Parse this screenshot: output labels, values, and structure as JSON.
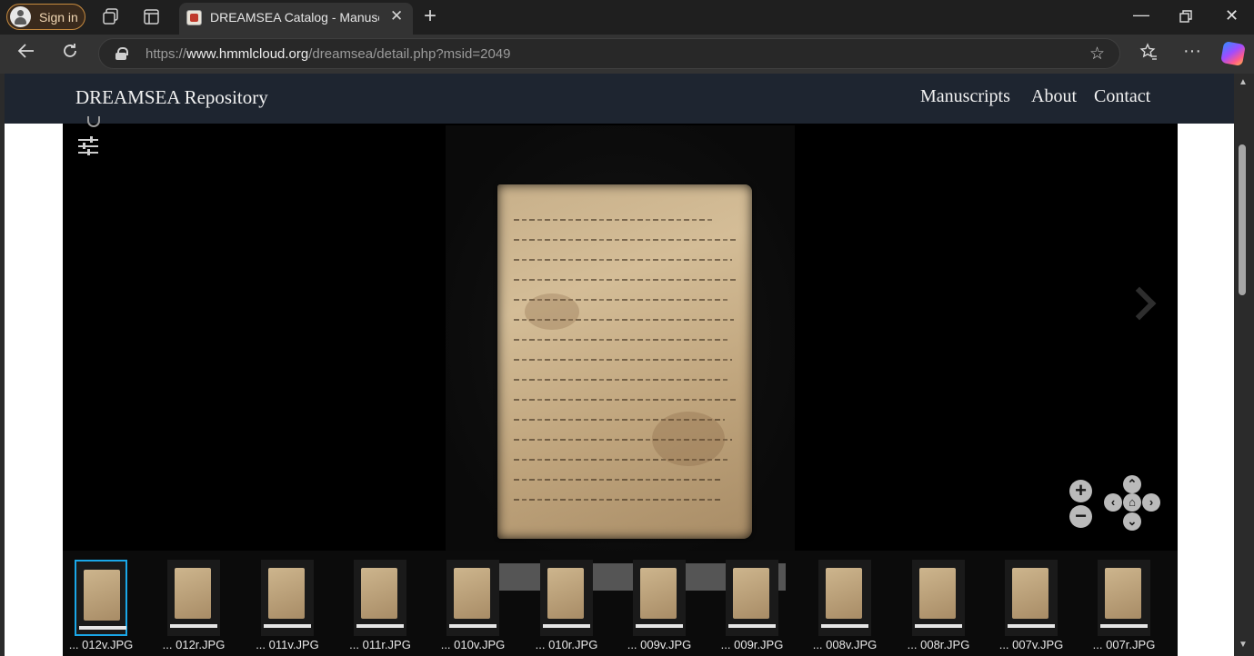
{
  "browser": {
    "signin_label": "Sign in",
    "tab_title": "DREAMSEA Catalog - Manuscript",
    "url_prefix": "https://",
    "url_host": "www.hmmlcloud.org",
    "url_path": "/dreamsea/detail.php?msid=2049"
  },
  "site": {
    "brand": "DREAMSEA Repository",
    "menu": [
      "Manuscripts",
      "About",
      "Contact"
    ]
  },
  "viewer": {
    "thumbnails": [
      {
        "label": "...  012v.JPG",
        "selected": true
      },
      {
        "label": "...  012r.JPG",
        "selected": false
      },
      {
        "label": "...  011v.JPG",
        "selected": false
      },
      {
        "label": "...  011r.JPG",
        "selected": false
      },
      {
        "label": "...  010v.JPG",
        "selected": false
      },
      {
        "label": "...  010r.JPG",
        "selected": false
      },
      {
        "label": "...  009v.JPG",
        "selected": false
      },
      {
        "label": "...  009r.JPG",
        "selected": false
      },
      {
        "label": "...  008v.JPG",
        "selected": false
      },
      {
        "label": "...  008r.JPG",
        "selected": false
      },
      {
        "label": "...  007v.JPG",
        "selected": false
      },
      {
        "label": "...  007r.JPG",
        "selected": false
      }
    ]
  },
  "colors": {
    "header_bg": "#1e2530",
    "selection": "#1aa7e8",
    "signin_border": "#c68a3f"
  }
}
